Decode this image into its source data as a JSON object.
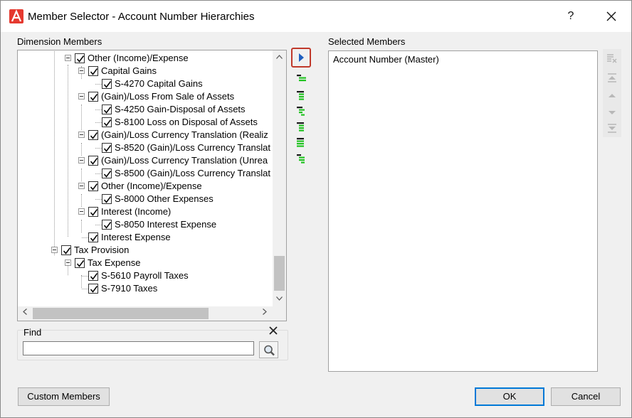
{
  "window": {
    "title": "Member Selector - Account Number Hierarchies",
    "help_label": "?",
    "accent": "#e5392f"
  },
  "dimension_members": {
    "label": "Dimension Members",
    "rows": [
      {
        "label": "Other (Income)/Expense",
        "level": 1,
        "expander": true,
        "checked": true
      },
      {
        "label": "Capital Gains",
        "level": 2,
        "expander": true,
        "checked": true
      },
      {
        "label": "S-4270 Capital Gains",
        "level": 3,
        "expander": false,
        "checked": true
      },
      {
        "label": "(Gain)/Loss From Sale of Assets",
        "level": 2,
        "expander": true,
        "checked": true
      },
      {
        "label": "S-4250 Gain-Disposal of Assets",
        "level": 3,
        "expander": false,
        "checked": true
      },
      {
        "label": "S-8100 Loss on Disposal of Assets",
        "level": 3,
        "expander": false,
        "checked": true
      },
      {
        "label": "(Gain)/Loss Currency Translation (Realiz",
        "level": 2,
        "expander": true,
        "checked": true
      },
      {
        "label": "S-8520 (Gain)/Loss Currency Translat",
        "level": 3,
        "expander": false,
        "checked": true
      },
      {
        "label": "(Gain)/Loss Currency Translation (Unrea",
        "level": 2,
        "expander": true,
        "checked": true
      },
      {
        "label": "S-8500 (Gain)/Loss Currency Translat",
        "level": 3,
        "expander": false,
        "checked": true
      },
      {
        "label": "Other (Income)/Expense",
        "level": 2,
        "expander": true,
        "checked": true
      },
      {
        "label": "S-8000 Other Expenses",
        "level": 3,
        "expander": false,
        "checked": true
      },
      {
        "label": "Interest (Income)",
        "level": 2,
        "expander": true,
        "checked": true
      },
      {
        "label": "S-8050 Interest Expense",
        "level": 3,
        "expander": false,
        "checked": true
      },
      {
        "label": "Interest Expense",
        "level": 2,
        "expander": false,
        "checked": true
      },
      {
        "label": "Tax Provision",
        "level": 0,
        "expander": true,
        "checked": true
      },
      {
        "label": "Tax Expense",
        "level": 1,
        "expander": true,
        "checked": true
      },
      {
        "label": "S-5610 Payroll Taxes",
        "level": 2,
        "expander": false,
        "checked": true
      },
      {
        "label": "S-7910 Taxes",
        "level": 2,
        "expander": false,
        "checked": true
      }
    ]
  },
  "find": {
    "label": "Find",
    "value": "",
    "placeholder": ""
  },
  "selected_members": {
    "label": "Selected Members",
    "items": [
      "Account Number (Master)"
    ]
  },
  "buttons": {
    "custom_members": "Custom Members",
    "ok": "OK",
    "cancel": "Cancel"
  },
  "level_tools": [
    "member-only",
    "children",
    "descendants",
    "level-0",
    "siblings",
    "base-members"
  ],
  "right_tools": [
    "remove-all",
    "move-to-top",
    "move-up",
    "move-down",
    "move-to-bottom"
  ]
}
